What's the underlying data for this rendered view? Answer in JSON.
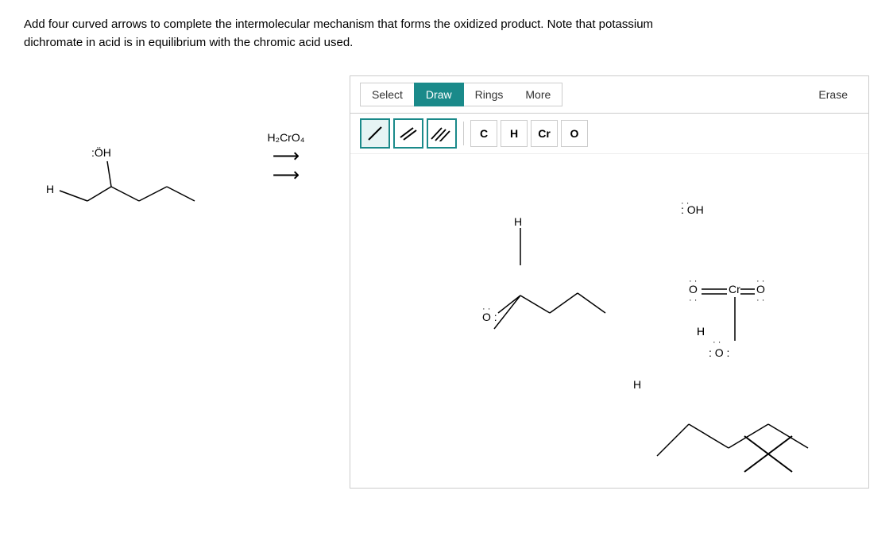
{
  "question": {
    "text_line1": "Add four curved arrows to complete the intermolecular mechanism that forms the oxidized product. Note that potassium",
    "text_line2": "dichromate in acid is in equilibrium with the chromic acid used."
  },
  "left_molecule": {
    "label": "alcohol molecule with OH group"
  },
  "reagent": {
    "label": "H₂CrO₄"
  },
  "toolbar": {
    "select_label": "Select",
    "draw_label": "Draw",
    "rings_label": "Rings",
    "more_label": "More",
    "erase_label": "Erase"
  },
  "bonds": {
    "single": "/",
    "double": "//",
    "triple": "///"
  },
  "atoms": {
    "C": "C",
    "H": "H",
    "Cr": "Cr",
    "O": "O"
  }
}
